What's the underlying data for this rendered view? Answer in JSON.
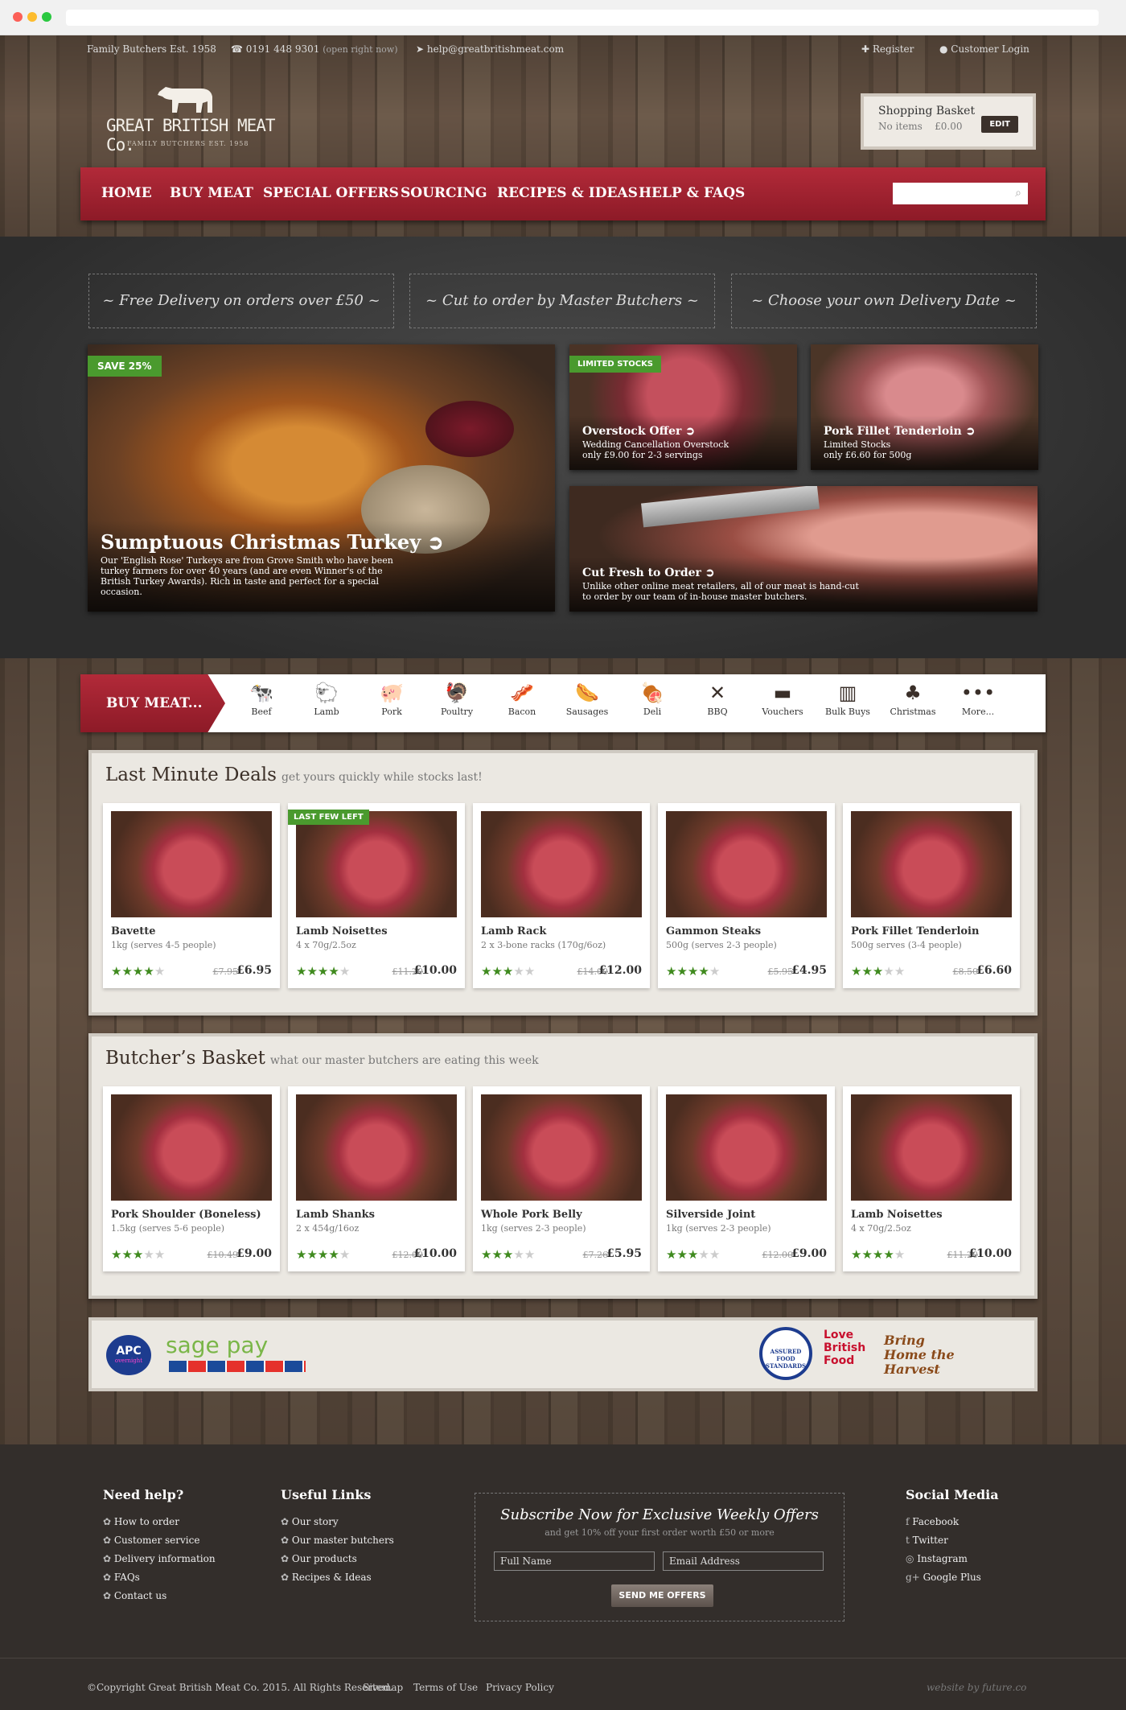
{
  "topbar": {
    "est": "Family Butchers Est. 1958",
    "phone": "0191 448 9301",
    "phone_note": "(open right now)",
    "email": "help@greatbritishmeat.com",
    "register": "Register",
    "login": "Customer Login"
  },
  "logo": {
    "name": "GREAT BRITISH MEAT Co.",
    "tagline": "FAMILY BUTCHERS EST. 1958"
  },
  "basket": {
    "title": "Shopping Basket",
    "items": "No items",
    "total": "£0.00",
    "edit": "EDIT"
  },
  "nav": [
    "HOME",
    "BUY MEAT",
    "SPECIAL OFFERS",
    "SOURCING",
    "RECIPES & IDEAS",
    "HELP & FAQS"
  ],
  "promos": [
    "Free Delivery on orders over £50",
    "Cut to order by Master Butchers",
    "Choose your own Delivery Date"
  ],
  "hero": {
    "main": {
      "tag": "SAVE 25%",
      "title": "Sumptuous Christmas Turkey",
      "text": "Our 'English Rose' Turkeys are from Grove Smith who have been turkey farmers for over 40 years (and are even Winner's of the British Turkey Awards). Rich in taste and perfect for a special occasion."
    },
    "overstock": {
      "tag": "LIMITED STOCKS",
      "title": "Overstock Offer",
      "line1": "Wedding Cancellation Overstock",
      "line2": "only £9.00 for 2-3 servings"
    },
    "fillet": {
      "title": "Pork Fillet Tenderloin",
      "line1": "Limited Stocks",
      "line2": "only £6.60 for 500g"
    },
    "cut": {
      "title": "Cut Fresh to Order",
      "line1": "Unlike other online meat retailers, all of our meat is hand-cut",
      "line2": "to order by our team of in-house master butchers."
    }
  },
  "buy_meat": {
    "label": "BUY MEAT...",
    "categories": [
      {
        "label": "Beef",
        "icon": "🐄"
      },
      {
        "label": "Lamb",
        "icon": "🐑"
      },
      {
        "label": "Pork",
        "icon": "🐖"
      },
      {
        "label": "Poultry",
        "icon": "🦃"
      },
      {
        "label": "Bacon",
        "icon": "🥓"
      },
      {
        "label": "Sausages",
        "icon": "🌭"
      },
      {
        "label": "Deli",
        "icon": "🍖"
      },
      {
        "label": "BBQ",
        "icon": "✕"
      },
      {
        "label": "Vouchers",
        "icon": "▬"
      },
      {
        "label": "Bulk Buys",
        "icon": "▥"
      },
      {
        "label": "Christmas",
        "icon": "♣"
      },
      {
        "label": "More...",
        "icon": "•••"
      }
    ]
  },
  "deals": {
    "title": "Last Minute Deals",
    "subtitle": "get yours quickly while stocks last!",
    "tag": "LAST FEW LEFT",
    "items": [
      {
        "name": "Bavette",
        "desc": "1kg (serves 4-5 people)",
        "old": "£7.95",
        "price": "£6.95",
        "stars": 4
      },
      {
        "name": "Lamb Noisettes",
        "desc": "4 x 70g/2.5oz",
        "old": "£11.20",
        "price": "£10.00",
        "stars": 4
      },
      {
        "name": "Lamb Rack",
        "desc": "2 x 3-bone racks (170g/6oz)",
        "old": "£14.00",
        "price": "£12.00",
        "stars": 3
      },
      {
        "name": "Gammon Steaks",
        "desc": "500g (serves 2-3 people)",
        "old": "£5.95",
        "price": "£4.95",
        "stars": 4
      },
      {
        "name": "Pork Fillet Tenderloin",
        "desc": "500g serves (3-4 people)",
        "old": "£8.50",
        "price": "£6.60",
        "stars": 3
      }
    ]
  },
  "basket_picks": {
    "title": "Butcher’s Basket",
    "subtitle": "what our master butchers are eating this week",
    "items": [
      {
        "name": "Pork Shoulder (Boneless)",
        "desc": "1.5kg (serves 5-6 people)",
        "old": "£10.49",
        "price": "£9.00",
        "stars": 3
      },
      {
        "name": "Lamb Shanks",
        "desc": "2 x 454g/16oz",
        "old": "£12.00",
        "price": "£10.00",
        "stars": 4
      },
      {
        "name": "Whole Pork Belly",
        "desc": "1kg (serves 2-3 people)",
        "old": "£7.26",
        "price": "£5.95",
        "stars": 3
      },
      {
        "name": "Silverside Joint",
        "desc": "1kg (serves 2-3 people)",
        "old": "£12.00",
        "price": "£9.00",
        "stars": 3
      },
      {
        "name": "Lamb Noisettes",
        "desc": "4 x 70g/2.5oz",
        "old": "£11.20",
        "price": "£10.00",
        "stars": 4
      }
    ]
  },
  "partners": {
    "apc": "APC",
    "apc_sub": "overnight",
    "sagepay": "sage pay",
    "assured": "ASSURED FOOD STANDARDS",
    "love": "Love British Food",
    "harvest": "Bring Home the Harvest"
  },
  "footer": {
    "help": {
      "title": "Need help?",
      "links": [
        "How to order",
        "Customer service",
        "Delivery information",
        "FAQs",
        "Contact us"
      ]
    },
    "useful": {
      "title": "Useful Links",
      "links": [
        "Our story",
        "Our master butchers",
        "Our products",
        "Recipes & Ideas"
      ]
    },
    "subscribe": {
      "title": "Subscribe Now for Exclusive Weekly Offers",
      "sub": "and get 10% off your first order worth £50 or more",
      "name": "Full Name",
      "email": "Email Address",
      "button": "SEND ME OFFERS"
    },
    "social": {
      "title": "Social Media",
      "links": [
        "Facebook",
        "Twitter",
        "Instagram",
        "Google Plus"
      ]
    },
    "copyright": "©Copyright Great British Meat Co. 2015. All Rights Reserved.",
    "sitemap": "Sitemap",
    "terms": "Terms of Use",
    "privacy": "Privacy Policy",
    "credit": "website by future.co"
  },
  "colors": {
    "accent": "#a3202f",
    "green": "#4a9a2e",
    "star": "#3f8a1e"
  }
}
